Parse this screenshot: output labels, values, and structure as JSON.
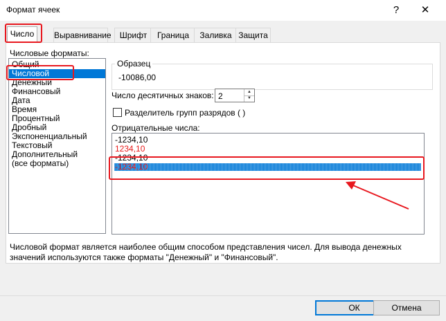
{
  "window": {
    "title": "Формат ячеек",
    "help": "?",
    "close": "✕"
  },
  "tabs": [
    {
      "label": "Число",
      "active": true
    },
    {
      "label": "Выравнивание"
    },
    {
      "label": "Шрифт"
    },
    {
      "label": "Граница"
    },
    {
      "label": "Заливка"
    },
    {
      "label": "Защита"
    }
  ],
  "formats": {
    "label": "Числовые форматы:",
    "items": [
      "Общий",
      "Числовой",
      "Денежный",
      "Финансовый",
      "Дата",
      "Время",
      "Процентный",
      "Дробный",
      "Экспоненциальный",
      "Текстовый",
      "Дополнительный",
      "(все форматы)"
    ],
    "selected": "Числовой"
  },
  "sample": {
    "label": "Образец",
    "value": "-10086,00"
  },
  "decimals": {
    "label": "Число десятичных знаков:",
    "value": "2"
  },
  "separator": {
    "label": "Разделитель групп разрядов ( )",
    "checked": false
  },
  "negative": {
    "label": "Отрицательные числа:",
    "items": [
      {
        "text": "-1234,10",
        "color": "#000000"
      },
      {
        "text": "1234,10",
        "color": "#e81b1b"
      },
      {
        "text": "-1234,10",
        "color": "#000000"
      },
      {
        "text": "-1234,10",
        "color": "#e81b1b",
        "selected": true
      }
    ]
  },
  "description": "Числовой формат является наиболее общим способом представления чисел. Для вывода денежных значений используются также форматы \"Денежный\" и \"Финансовый\".",
  "buttons": {
    "ok": "ОК",
    "cancel": "Отмена"
  },
  "colors": {
    "accent": "#0078d7",
    "highlight": "#e8171e"
  }
}
